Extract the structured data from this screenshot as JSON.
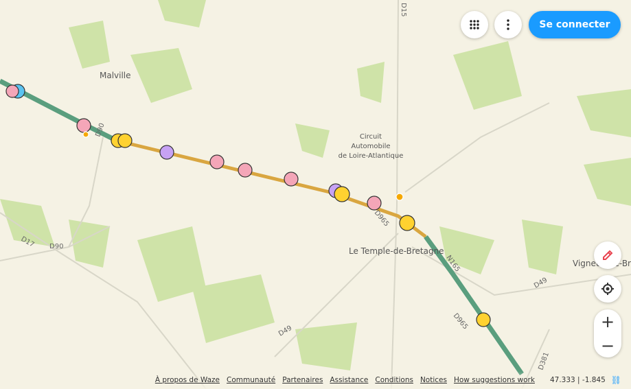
{
  "header": {
    "login_label": "Se connecter",
    "apps_icon": "grid-icon",
    "more_icon": "more-vertical-icon"
  },
  "map": {
    "places": [
      "Malville",
      "Le Temple-de-Bretagne",
      "Vigneux-de-Bre"
    ],
    "poi": [
      "Circuit",
      "Automobile",
      "de Loire-Atlantique"
    ],
    "roads": [
      "D17",
      "D90",
      "D90",
      "D49",
      "D49",
      "D965",
      "D965",
      "D15",
      "N165",
      "D381"
    ],
    "colors": {
      "route_green": "#5a9e7e",
      "route_orange": "#d9a640",
      "background": "#f5f2e4",
      "wood": "#cfe3a8"
    }
  },
  "controls": {
    "report_icon": "pencil-icon",
    "locate_icon": "crosshair-icon",
    "zoom_in": "+",
    "zoom_out": "−"
  },
  "footer": {
    "links": [
      "À propos de Waze",
      "Communauté",
      "Partenaires",
      "Assistance",
      "Conditions",
      "Notices",
      "How suggestions work"
    ],
    "coords": "47.333 | -1.845",
    "link_icon": "link-icon"
  }
}
